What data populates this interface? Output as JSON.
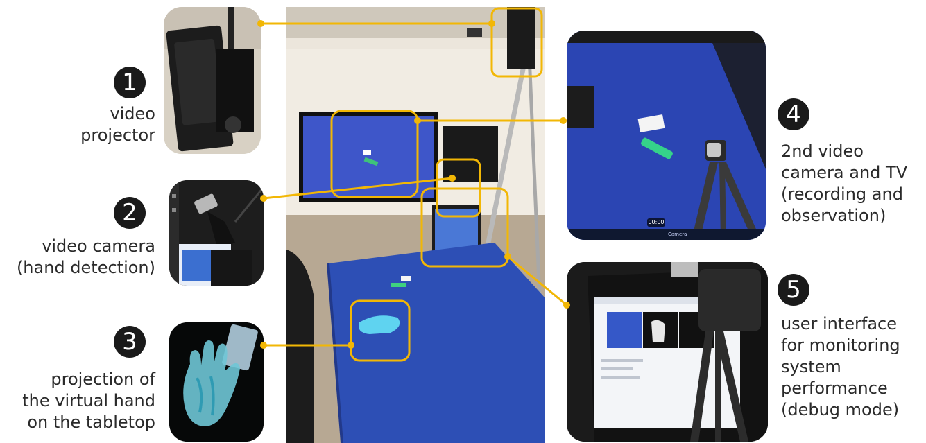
{
  "items": [
    {
      "number": "1",
      "label_lines": [
        "video",
        "projector"
      ]
    },
    {
      "number": "2",
      "label_lines": [
        "video camera",
        "(hand detection)"
      ]
    },
    {
      "number": "3",
      "label_lines": [
        "projection of",
        "the virtual hand",
        "on the tabletop"
      ]
    },
    {
      "number": "4",
      "label_lines": [
        "2nd video",
        "camera and TV",
        "(recording and",
        "observation)"
      ]
    },
    {
      "number": "5",
      "label_lines": [
        "user interface",
        "for monitoring",
        "system",
        "performance",
        "(debug mode)"
      ]
    }
  ],
  "screen_text": {
    "timer": "00:00",
    "taskbar_item": "Camera"
  },
  "colors": {
    "callout": "#f2b705",
    "table_blue": "#2d4fb5",
    "number_badge": "#1a1a1a"
  }
}
